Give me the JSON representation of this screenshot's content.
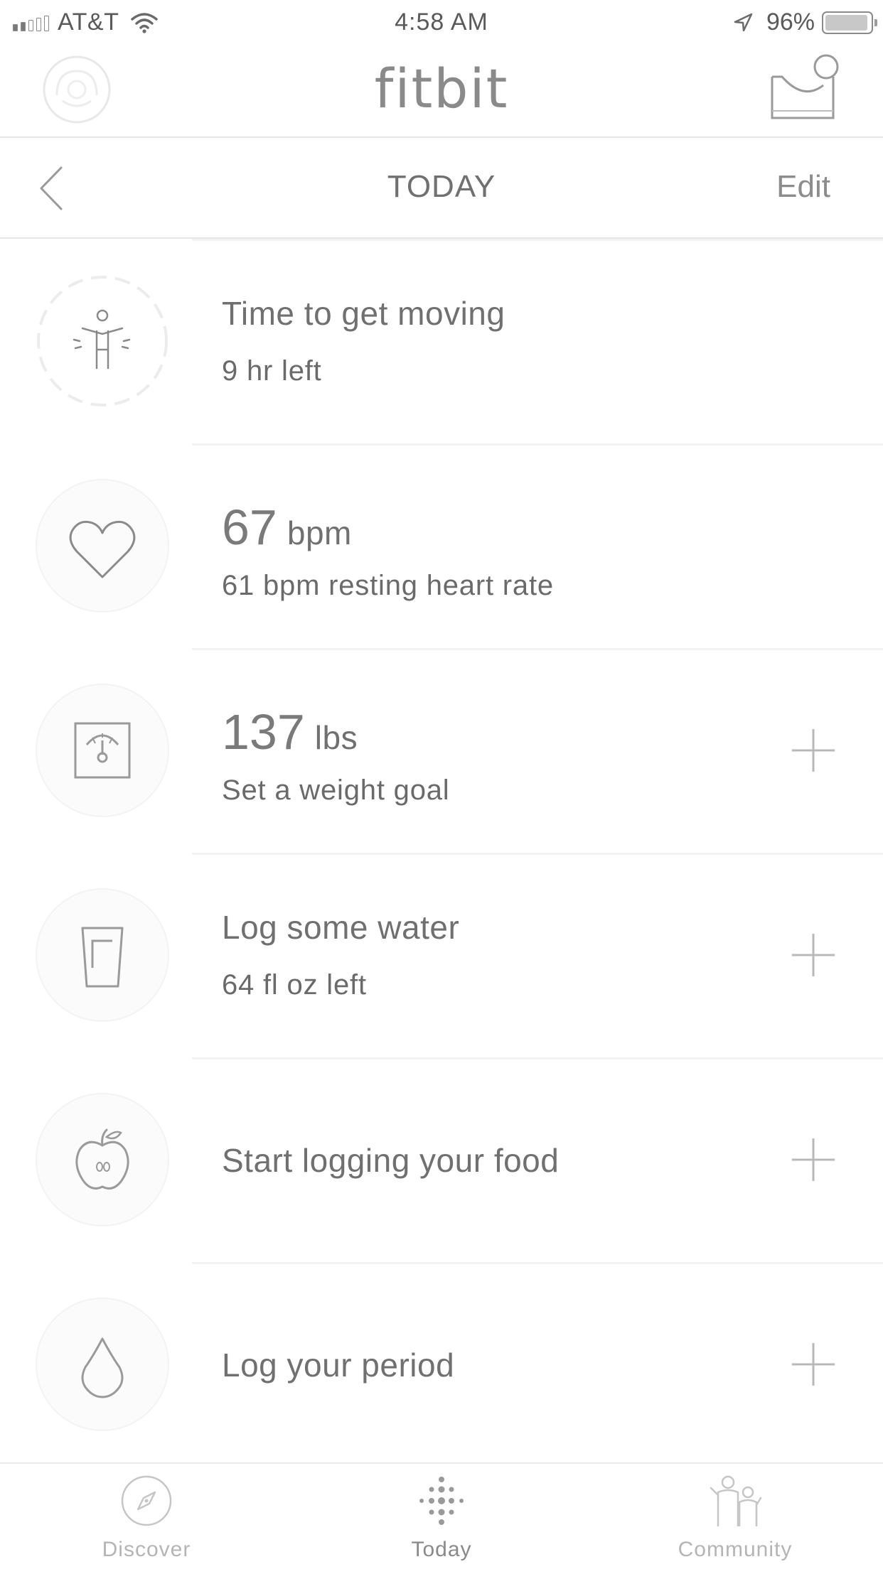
{
  "status_bar": {
    "carrier": "AT&T",
    "time": "4:58 AM",
    "battery_percent": "96%",
    "battery_level": 0.96,
    "signal_bars_filled": 2,
    "signal_bars_total": 5
  },
  "header": {
    "brand": "fitbit",
    "avatar_icon": "user-avatar-icon",
    "inbox_icon": "inbox-icon"
  },
  "nav": {
    "back_icon": "chevron-left-icon",
    "title": "TODAY",
    "edit_label": "Edit"
  },
  "tiles": [
    {
      "icon": "hourly-activity-icon",
      "title": "Time to get moving",
      "subtitle": "9 hr left",
      "has_add": false
    },
    {
      "icon": "heart-icon",
      "value": "67",
      "unit": "bpm",
      "subtitle": "61 bpm resting heart rate",
      "has_add": false
    },
    {
      "icon": "scale-icon",
      "value": "137",
      "unit": "lbs",
      "subtitle": "Set a weight goal",
      "has_add": true
    },
    {
      "icon": "water-glass-icon",
      "title": "Log some water",
      "subtitle": "64 fl oz left",
      "has_add": true
    },
    {
      "icon": "apple-icon",
      "title": "Start logging your food",
      "has_add": true
    },
    {
      "icon": "drop-icon",
      "title": "Log your period",
      "has_add": true
    }
  ],
  "tab_bar": {
    "items": [
      {
        "label": "Discover",
        "icon": "compass-icon",
        "active": false
      },
      {
        "label": "Today",
        "icon": "fitbit-dots-icon",
        "active": true
      },
      {
        "label": "Community",
        "icon": "community-icon",
        "active": false
      }
    ]
  },
  "colors": {
    "text_primary": "#707070",
    "text_muted": "#b5b5b5",
    "divider": "#e6e6e6",
    "background": "#ffffff"
  }
}
